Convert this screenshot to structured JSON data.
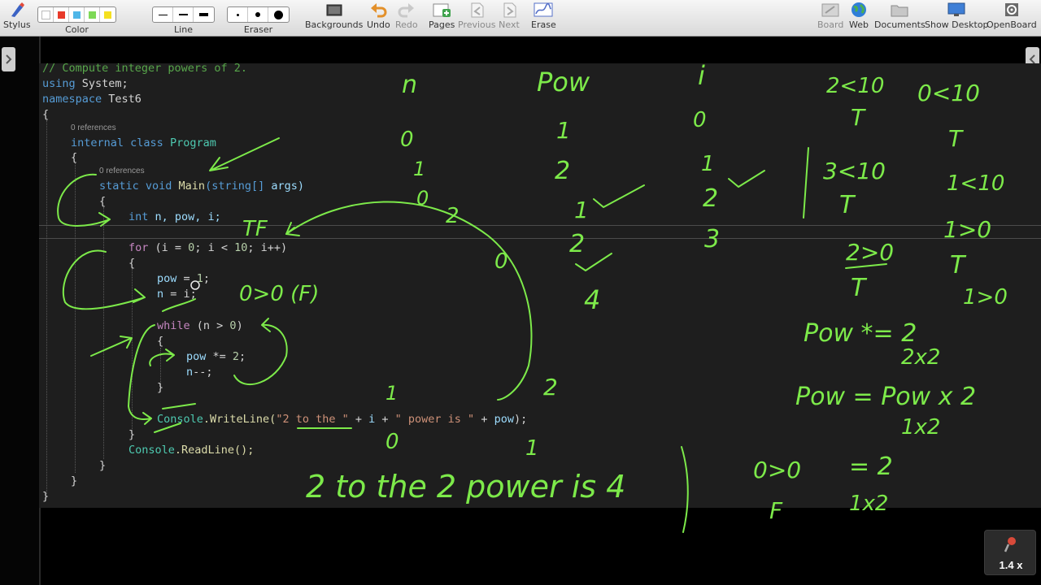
{
  "toolbar": {
    "stylus": "Stylus",
    "color": "Color",
    "line": "Line",
    "eraser": "Eraser",
    "backgrounds": "Backgrounds",
    "undo": "Undo",
    "redo": "Redo",
    "pages": "Pages",
    "previous": "Previous",
    "next": "Next",
    "erase": "Erase",
    "board": "Board",
    "web": "Web",
    "documents": "Documents",
    "show_desktop": "Show Desktop",
    "openboard": "OpenBoard",
    "palette_colors": [
      "#ffffff",
      "#e83a2a",
      "#4fb6e8",
      "#7ed957",
      "#f5e020"
    ]
  },
  "code": {
    "comment": "// Compute integer powers of 2.",
    "refs_class": "0 references",
    "refs_main": "0 references",
    "using_kw": "using",
    "using_ns": "System;",
    "namespace_kw": "namespace",
    "namespace_name": "Test6",
    "open_brace": "{",
    "close_brace": "}",
    "class_mods": "internal class",
    "class_name": "Program",
    "main_mods": "static void",
    "main_name": "Main",
    "main_params_type": "(string[]",
    "main_params_name": "args)",
    "decl_kw": "int",
    "decl_vars": "n, pow, i;",
    "for_kw": "for",
    "for_rest_a": "(i = ",
    "for_num_a": "0",
    "for_rest_b": "; i < ",
    "for_num_b": "10",
    "for_rest_c": "; i++)",
    "pow_assign": "pow",
    "pow_assign_rest": " = ",
    "pow_assign_val": "1",
    "pow_assign_end": ";",
    "n_assign": "n",
    "n_assign_rest": " = i;",
    "while_kw": "while",
    "while_rest_a": " (n > ",
    "while_num": "0",
    "while_rest_b": ")",
    "pow_mul": "pow",
    "pow_mul_rest": " *= ",
    "pow_mul_val": "2",
    "pow_mul_end": ";",
    "n_dec": "n",
    "n_dec_rest": "--;",
    "console": "Console",
    "writeline": ".WriteLine(",
    "str_a": "\"2 to the \"",
    "plus_i": " + ",
    "var_i": "i",
    "plus_b": " + ",
    "str_b": "\" power is \"",
    "plus_c": " + ",
    "var_pow": "pow",
    "writeline_end": ");",
    "console2": "Console",
    "readline": ".ReadLine();"
  },
  "ink": {
    "header_n": "n",
    "header_pow": "Pow",
    "header_i": "i",
    "n_vals": [
      "0",
      "1",
      "0",
      "2",
      "0"
    ],
    "pow_vals": [
      "1",
      "2",
      "1",
      "2",
      "4"
    ],
    "i_vals": [
      "0",
      "1",
      "2",
      "3"
    ],
    "cond_1": "2<10",
    "cond_1_t": "T",
    "cond_2": "0<10",
    "cond_2_t": "T",
    "cond_3": "3<10",
    "cond_3_t": "T",
    "cond_4": "1<10",
    "cond_5": "1>0",
    "cond_5_t": "T",
    "cond_6": "1>0",
    "cond_7": "2>0",
    "cond_7_t": "T",
    "tf": "TF",
    "zero_gt": "0>0 (F)",
    "pow_times": "Pow *= 2",
    "two_x_two": "2x2",
    "pow_eq": "Pow = Pow x 2",
    "one_x_two": "1x2",
    "eq_two": "= 2",
    "one_x_two_b": "1x2",
    "zero_gt_b": "0>0",
    "f_b": "F",
    "loose_1": "1",
    "loose_0": "0",
    "loose_2": "2",
    "loose_1b": "1",
    "sentence": "2 to the 2 power is 4"
  },
  "zoom": "1.4 x"
}
